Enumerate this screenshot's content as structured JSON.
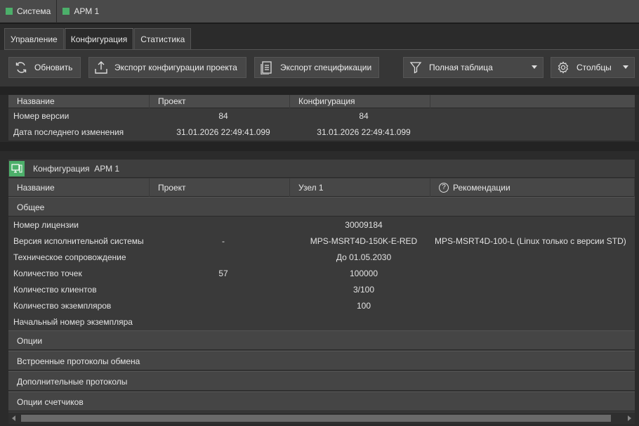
{
  "breadcrumbs": [
    {
      "label": "Система"
    },
    {
      "label": "АРМ 1"
    }
  ],
  "tabs": [
    {
      "label": "Управление"
    },
    {
      "label": "Конфигурация"
    },
    {
      "label": "Статистика"
    }
  ],
  "toolbar": {
    "refresh_label": "Обновить",
    "export_config_label": "Экспорт конфигурации проекта",
    "export_spec_label": "Экспорт спецификации",
    "filter_label": "Полная таблица",
    "columns_label": "Столбцы"
  },
  "version_table": {
    "headers": [
      "Название",
      "Проект",
      "Конфигурация"
    ],
    "rows": [
      {
        "name": "Номер версии",
        "project": "84",
        "config": "84"
      },
      {
        "name": "Дата последнего изменения",
        "project": "31.01.2026 22:49:41.099",
        "config": "31.01.2026 22:49:41.099"
      }
    ]
  },
  "config_panel": {
    "title": "Конфигурация  АРМ 1",
    "headers": [
      "Название",
      "Проект",
      "Узел 1",
      "Рекомендации"
    ],
    "general_group": "Общее",
    "rows": [
      {
        "name": "Номер лицензии",
        "project": "",
        "node": "30009184",
        "rec": ""
      },
      {
        "name": "Версия исполнительной системы",
        "project": "-",
        "node": "MPS-MSRT4D-150K-E-RED",
        "rec": "MPS-MSRT4D-100-L (Linux только с версии STD)"
      },
      {
        "name": "Техническое сопровождение",
        "project": "",
        "node": "До 01.05.2030",
        "rec": ""
      },
      {
        "name": "Количество точек",
        "project": "57",
        "node": "100000",
        "rec": ""
      },
      {
        "name": "Количество клиентов",
        "project": "",
        "node": "3/100",
        "rec": ""
      },
      {
        "name": "Количество экземпляров",
        "project": "",
        "node": "100",
        "rec": ""
      },
      {
        "name": "Начальный номер экземпляра",
        "project": "",
        "node": "",
        "rec": ""
      }
    ],
    "groups": [
      "Опции",
      "Встроенные протоколы обмена",
      "Дополнительные протоколы",
      "Опции счетчиков"
    ]
  },
  "colors": {
    "accent": "#4caf6a",
    "background": "#2b2b2b"
  }
}
